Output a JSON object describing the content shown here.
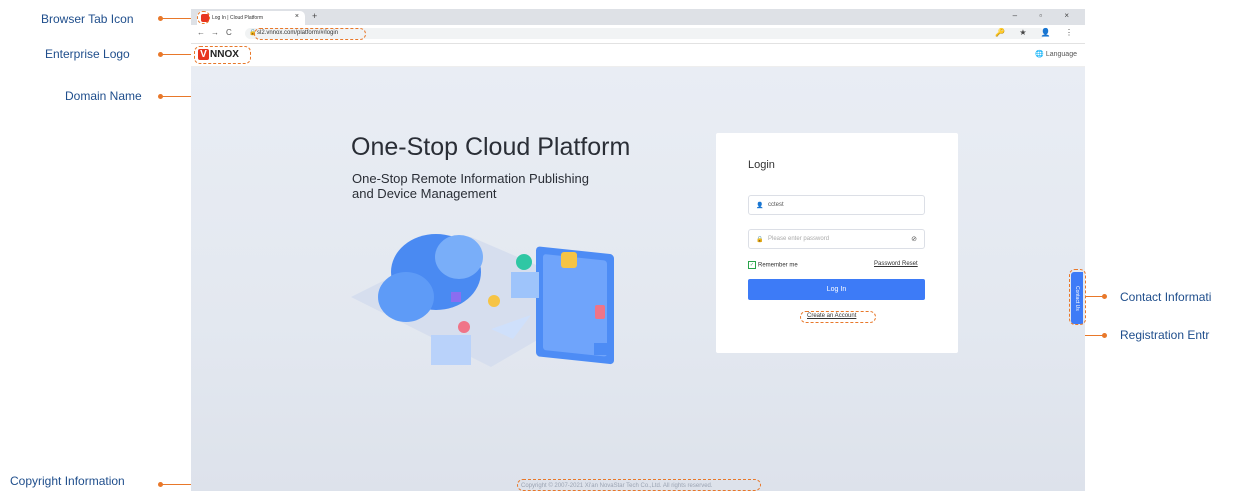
{
  "annotations": {
    "browser_tab_icon": "Browser Tab Icon",
    "enterprise_logo": "Enterprise Logo",
    "domain_name": "Domain Name",
    "copyright_information": "Copyright Information",
    "contact_information": "Contact Informati",
    "registration_entry": "Registration Entr"
  },
  "browser": {
    "tab_title": "Log In | Cloud Platform",
    "tab_close": "×",
    "new_tab": "+",
    "window_controls": "–  ▫  ×",
    "back": "←",
    "forward": "→",
    "reload": "C",
    "url": "sl2.vnnox.com/platform/#/login",
    "toolbar_icons": "🔑 ★ 👤 ⋮"
  },
  "site": {
    "logo_text": "NNOX",
    "logo_mark": "V",
    "language": "Language"
  },
  "hero": {
    "title": "One-Stop Cloud Platform",
    "subtitle_line1": "One-Stop Remote Information Publishing",
    "subtitle_line2": "and Device Management"
  },
  "login": {
    "heading": "Login",
    "username_value": "cctest",
    "password_placeholder": "Please enter password",
    "remember_me": "Remember me",
    "password_reset": "Password Reset",
    "login_button": "Log In",
    "create_account": "Create an Account"
  },
  "contact_tab": "Contact Us",
  "copyright": "Copyright © 2007-2021 Xi'an NovaStar Tech Co.,Ltd. All rights reserved.",
  "colors": {
    "annotation": "#e8782a",
    "annotation_text": "#1f4e8c",
    "primary": "#3d7bf7",
    "logo_red": "#e8351f"
  }
}
